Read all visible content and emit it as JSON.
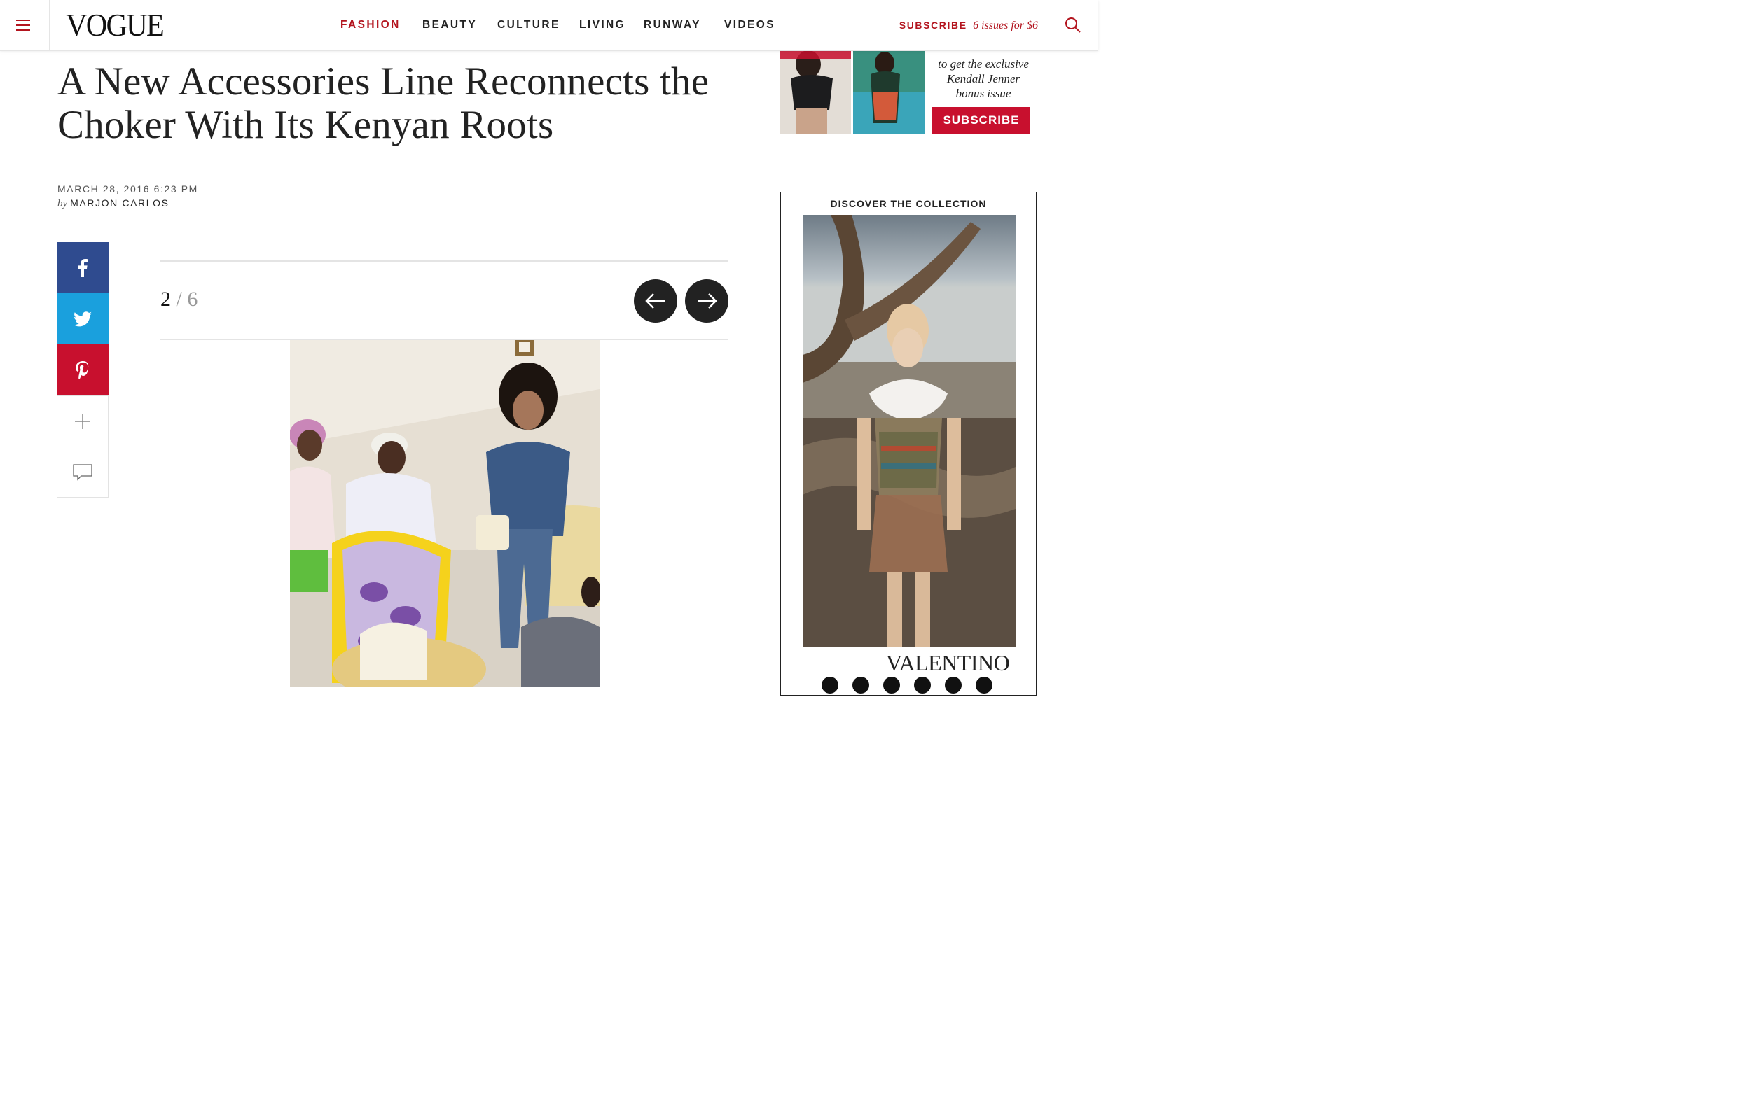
{
  "header": {
    "logo": "VOGUE",
    "nav": [
      {
        "label": "FASHION",
        "active": true
      },
      {
        "label": "BEAUTY",
        "active": false
      },
      {
        "label": "CULTURE",
        "active": false
      },
      {
        "label": "LIVING",
        "active": false
      },
      {
        "label": "RUNWAY",
        "active": false
      },
      {
        "label": "VIDEOS",
        "active": false
      }
    ],
    "subscribe_label": "SUBSCRIBE",
    "subscribe_offer": "6 issues for $6",
    "menu_icon": "hamburger-icon",
    "search_icon": "search-icon"
  },
  "article": {
    "headline": "A New Accessories Line Reconnects the Choker With Its Kenyan Roots",
    "date": "MARCH 28, 2016 6:23 PM",
    "by": "by",
    "author": "MARJON CARLOS"
  },
  "share": {
    "icons": [
      "facebook-icon",
      "twitter-icon",
      "pinterest-icon",
      "plus-icon",
      "comment-icon"
    ]
  },
  "gallery": {
    "current": "2",
    "separator": "/",
    "total": "6",
    "prev_icon": "arrow-left-icon",
    "next_icon": "arrow-right-icon"
  },
  "subscribe_ad": {
    "line1": "to get the exclusive",
    "line2": "Kendall Jenner",
    "line3": "bonus issue",
    "button": "SUBSCRIBE"
  },
  "collection_ad": {
    "label": "DISCOVER THE COLLECTION",
    "brand": "VALENTINO",
    "social_icons": [
      "facebook-icon",
      "twitter-icon",
      "instagram-icon",
      "pinterest-icon",
      "google-plus-icon",
      "tumblr-icon"
    ]
  },
  "colors": {
    "accent": "#b3141e",
    "facebook": "#2f4b8f",
    "twitter": "#1aa0dd",
    "pinterest": "#c8102e"
  }
}
